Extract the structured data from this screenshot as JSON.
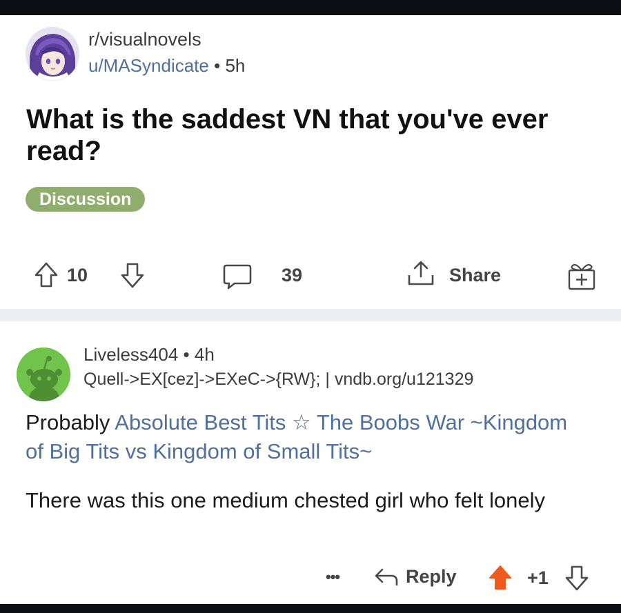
{
  "post": {
    "subreddit": "r/visualnovels",
    "author": "u/MASyndicate",
    "separator": " • ",
    "age": "5h",
    "title": "What is the saddest VN that you've ever read?",
    "flair": "Discussion",
    "flair_color": "#8fae6e",
    "vote_count": "10",
    "comment_count": "39",
    "share_label": "Share",
    "icons": [
      "upvote-icon",
      "downvote-icon",
      "comment-icon",
      "share-icon",
      "award-icon"
    ]
  },
  "comment": {
    "author": "Liveless404",
    "separator": " • ",
    "age": "4h",
    "user_flair": "Quell->EX[cez]->EXeC->{RW}; | vndb.org/u121329",
    "body_prefix": "Probably ",
    "link_text": "Absolute Best Tits ☆ The Boobs War ~Kingdom of Big Tits vs Kingdom of Small Tits~",
    "body_second": "There was this one medium chested girl who felt lonely",
    "more_label": "•••",
    "reply_label": "Reply",
    "vote_label": "+1",
    "upvote_active_color": "#ef5a1d",
    "link_color": "#4f6f9c",
    "avatar_color": "#71c44b"
  }
}
